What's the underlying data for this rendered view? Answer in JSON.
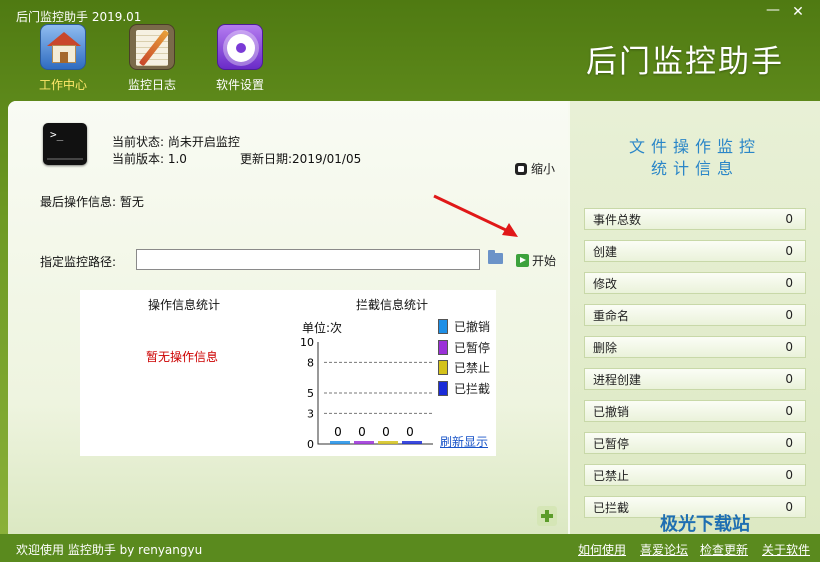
{
  "window": {
    "title": "后门监控助手 2019.01",
    "minimize": "—",
    "close": "✕"
  },
  "toolbar": [
    {
      "label": "工作中心",
      "icon": "home-icon",
      "active": true
    },
    {
      "label": "监控日志",
      "icon": "log-icon",
      "active": false
    },
    {
      "label": "软件设置",
      "icon": "settings-icon",
      "active": false
    }
  ],
  "brand": "后门监控助手",
  "info": {
    "status": "当前状态: 尚未开启监控",
    "version": "当前版本: 1.0",
    "update_date": "更新日期:2019/01/05",
    "minimize_label": "缩小",
    "last_op": "最后操作信息: 暂无"
  },
  "path": {
    "label": "指定监控路径:",
    "value": "",
    "start_label": "开始"
  },
  "stats": {
    "op_title": "操作信息统计",
    "no_op": "暂无操作信息",
    "block_title": "拦截信息统计",
    "unit": "单位:次",
    "refresh": "刷新显示"
  },
  "chart_data": {
    "type": "bar",
    "title": "拦截信息统计",
    "ylabel": "单位:次",
    "ylim": [
      0,
      10
    ],
    "yticks": [
      0,
      3,
      5,
      8,
      10
    ],
    "categories": [
      "已撤销",
      "已暂停",
      "已禁止",
      "已拦截"
    ],
    "values": [
      0,
      0,
      0,
      0
    ],
    "colors": [
      "#1e8fe6",
      "#9b30d8",
      "#d4c21a",
      "#1a2bd8"
    ],
    "legend": [
      "已撤销",
      "已暂停",
      "已禁止",
      "已拦截"
    ]
  },
  "right_panel": {
    "title_line1": "文件操作监控",
    "title_line2": "统计信息",
    "rows": [
      {
        "label": "事件总数",
        "value": "0"
      },
      {
        "label": "创建",
        "value": "0"
      },
      {
        "label": "修改",
        "value": "0"
      },
      {
        "label": "重命名",
        "value": "0"
      },
      {
        "label": "删除",
        "value": "0"
      },
      {
        "label": "进程创建",
        "value": "0"
      },
      {
        "label": "已撤销",
        "value": "0"
      },
      {
        "label": "已暂停",
        "value": "0"
      },
      {
        "label": "已禁止",
        "value": "0"
      },
      {
        "label": "已拦截",
        "value": "0"
      }
    ]
  },
  "status": {
    "welcome": "欢迎使用 监控助手  by  renyangyu",
    "links": [
      "如何使用",
      "喜爱论坛",
      "检查更新",
      "关于软件"
    ]
  },
  "watermark": "极光下载站"
}
